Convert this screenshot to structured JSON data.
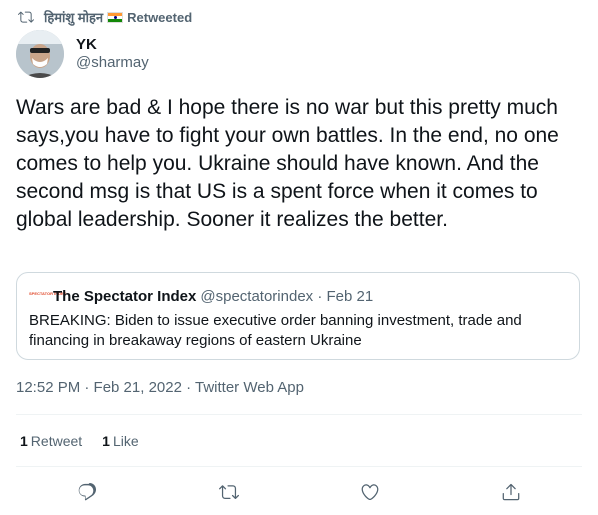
{
  "retweet_bar": {
    "icon": "retweet-icon",
    "retweeter_name": "हिमांशु मोहन",
    "flag_icon": "india-flag-icon",
    "label": "Retweeted"
  },
  "author": {
    "avatar_icon": "avatar",
    "name": "YK",
    "handle": "@sharmay"
  },
  "tweet": {
    "text": "Wars are bad & I hope there is no war but this pretty much says,you have to fight your own battles. In the end, no one comes to help you. Ukraine should have known. And the second msg is that US is a spent force when it comes to global leadership. Sooner it realizes the better."
  },
  "quote": {
    "avatar_text": "SPECTATOR INDEX",
    "name": "The Spectator Index",
    "meta": "@spectatorindex · Feb 21",
    "text": "BREAKING: Biden to issue executive order banning investment, trade and financing in breakaway regions of eastern Ukraine"
  },
  "timestamp": {
    "text": "12:52 PM · Feb 21, 2022 · Twitter Web App"
  },
  "stats": {
    "retweets_count": "1",
    "retweets_label": "Retweet",
    "likes_count": "1",
    "likes_label": "Like"
  },
  "actions": {
    "reply_icon": "reply-icon",
    "retweet_icon": "retweet-icon",
    "like_icon": "heart-icon",
    "share_icon": "share-icon"
  },
  "colors": {
    "text_primary": "#0f1419",
    "text_secondary": "#536471",
    "border": "#cfd9de"
  }
}
